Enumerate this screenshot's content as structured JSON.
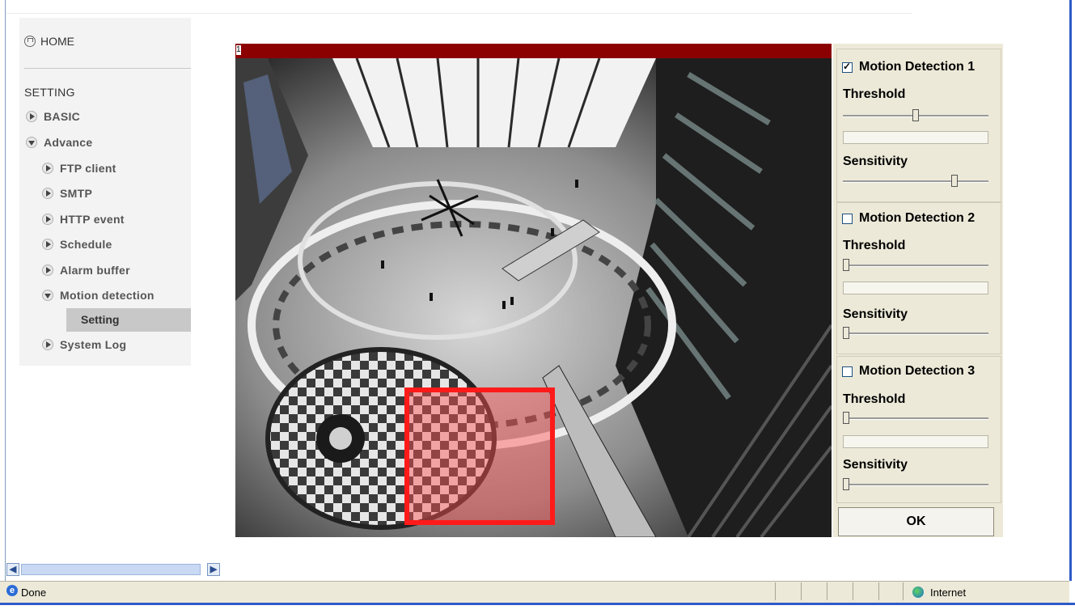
{
  "sidebar": {
    "home_label": "HOME",
    "section_title": "SETTING",
    "items": [
      {
        "label": "BASIC",
        "expanded": false
      },
      {
        "label": "Advance",
        "expanded": true
      },
      {
        "label": "FTP client",
        "expanded": false
      },
      {
        "label": "SMTP",
        "expanded": false
      },
      {
        "label": "HTTP event",
        "expanded": false
      },
      {
        "label": "Schedule",
        "expanded": false
      },
      {
        "label": "Alarm buffer",
        "expanded": false
      },
      {
        "label": "Motion detection",
        "expanded": true
      },
      {
        "label": "System Log",
        "expanded": false
      }
    ],
    "selected_sub_item": "Setting"
  },
  "camera": {
    "channel_tag": "1"
  },
  "motion_panel": {
    "detections": [
      {
        "label": "Motion Detection 1",
        "checked": true,
        "threshold_label": "Threshold",
        "threshold_level": 0.5,
        "sensitivity_label": "Sensitivity",
        "sensitivity_level": 0.78
      },
      {
        "label": "Motion Detection 2",
        "checked": false,
        "threshold_label": "Threshold",
        "threshold_level": 0.0,
        "sensitivity_label": "Sensitivity",
        "sensitivity_level": 0.0
      },
      {
        "label": "Motion Detection 3",
        "checked": false,
        "threshold_label": "Threshold",
        "threshold_level": 0.0,
        "sensitivity_label": "Sensitivity",
        "sensitivity_level": 0.0
      }
    ],
    "ok_label": "OK"
  },
  "statusbar": {
    "status_text": "Done",
    "zone_text": "Internet"
  },
  "colors": {
    "motion_window": "#ff1a1a",
    "camera_bar": "#8b0000",
    "panel_bg": "#ece9d8"
  }
}
